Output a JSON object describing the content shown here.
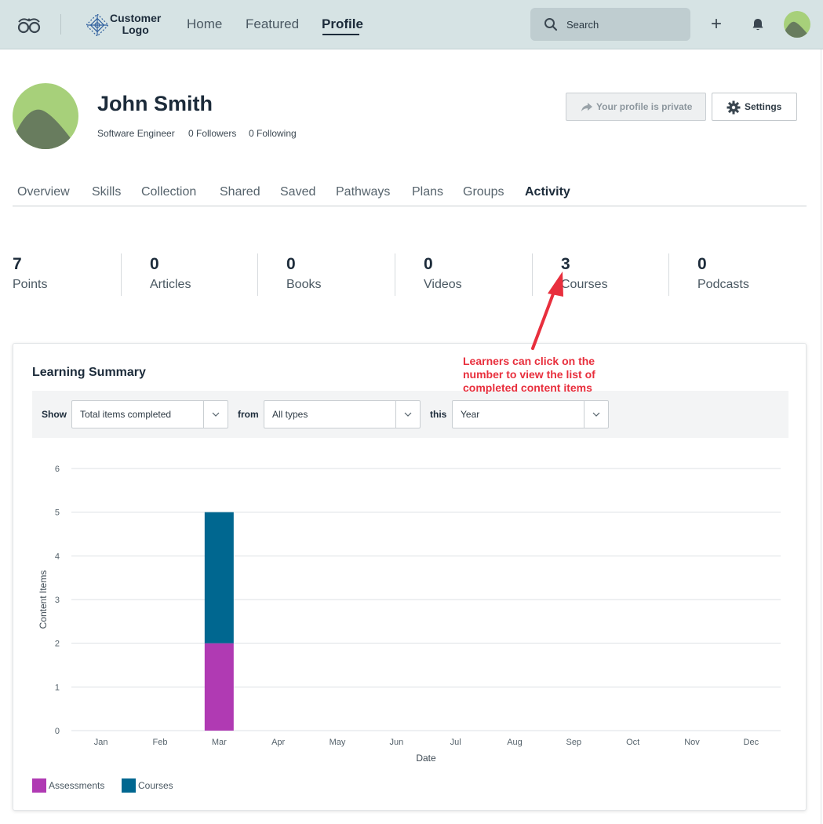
{
  "topbar": {
    "logo_line1": "Customer",
    "logo_line2": "Logo",
    "nav": [
      {
        "label": "Home"
      },
      {
        "label": "Featured"
      },
      {
        "label": "Profile"
      }
    ],
    "search_label": "Search",
    "plus_label": "+"
  },
  "profile": {
    "name": "John Smith",
    "title": "Software Engineer",
    "followers": "0 Followers",
    "following": "0 Following",
    "private_label": "Your profile is private",
    "settings_label": "Settings"
  },
  "tabs": [
    {
      "label": "Overview"
    },
    {
      "label": "Skills"
    },
    {
      "label": "Collection"
    },
    {
      "label": "Shared"
    },
    {
      "label": "Saved"
    },
    {
      "label": "Pathways"
    },
    {
      "label": "Plans"
    },
    {
      "label": "Groups"
    },
    {
      "label": "Activity"
    }
  ],
  "stats": [
    {
      "value": "7",
      "label": "Points"
    },
    {
      "value": "0",
      "label": "Articles"
    },
    {
      "value": "0",
      "label": "Books"
    },
    {
      "value": "0",
      "label": "Videos"
    },
    {
      "value": "3",
      "label": "Courses"
    },
    {
      "value": "0",
      "label": "Podcasts"
    }
  ],
  "annotation": {
    "line1": "Learners can click on the",
    "line2": "number to view the list of",
    "line3": "completed content items"
  },
  "summary": {
    "title": "Learning Summary",
    "show_label": "Show",
    "show_value": "Total items completed",
    "from_label": "from",
    "from_value": "All types",
    "this_label": "this",
    "this_value": "Year"
  },
  "colors": {
    "assessments": "#b03ab3",
    "courses": "#006790",
    "annotation": "#e82f3d"
  },
  "chart_data": {
    "type": "bar",
    "stacked": true,
    "categories": [
      "Jan",
      "Feb",
      "Mar",
      "Apr",
      "May",
      "Jun",
      "Jul",
      "Aug",
      "Sep",
      "Oct",
      "Nov",
      "Dec"
    ],
    "series": [
      {
        "name": "Assessments",
        "values": [
          0,
          0,
          2,
          0,
          0,
          0,
          0,
          0,
          0,
          0,
          0,
          0
        ]
      },
      {
        "name": "Courses",
        "values": [
          0,
          0,
          3,
          0,
          0,
          0,
          0,
          0,
          0,
          0,
          0,
          0
        ]
      }
    ],
    "xlabel": "Date",
    "ylabel": "Content Items",
    "ylim": [
      0,
      6
    ],
    "yticks": [
      0,
      1,
      2,
      3,
      4,
      5,
      6
    ],
    "grid": true,
    "legend": "bottom-left"
  }
}
